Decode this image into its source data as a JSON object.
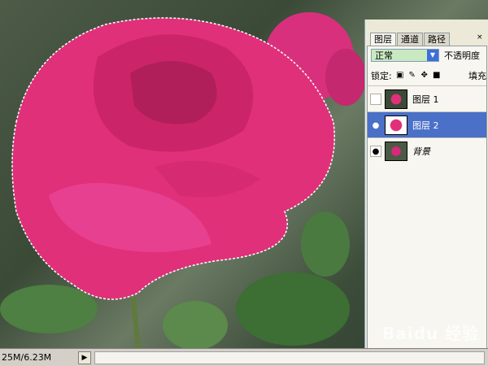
{
  "status": {
    "doc_size": "25M/6.23M",
    "arrow_glyph": "▶"
  },
  "palette": {
    "tabs": [
      {
        "label": "图层",
        "active": true
      },
      {
        "label": "通道",
        "active": false
      },
      {
        "label": "路径",
        "active": false
      }
    ],
    "close_glyph": "×",
    "blend_mode": "正常",
    "opacity_label": "不透明度",
    "lock_label": "锁定:",
    "fill_label": "填充",
    "layers": [
      {
        "name": "图层 1",
        "visible": false,
        "selected": false
      },
      {
        "name": "图层 2",
        "visible": true,
        "selected": true
      },
      {
        "name": "背景",
        "visible": true,
        "selected": false
      }
    ]
  },
  "watermark": "Baidu 经验",
  "colors": {
    "rose": "#e0307a",
    "selection": "#4a70c8",
    "panel_bg": "#ece9d8"
  }
}
